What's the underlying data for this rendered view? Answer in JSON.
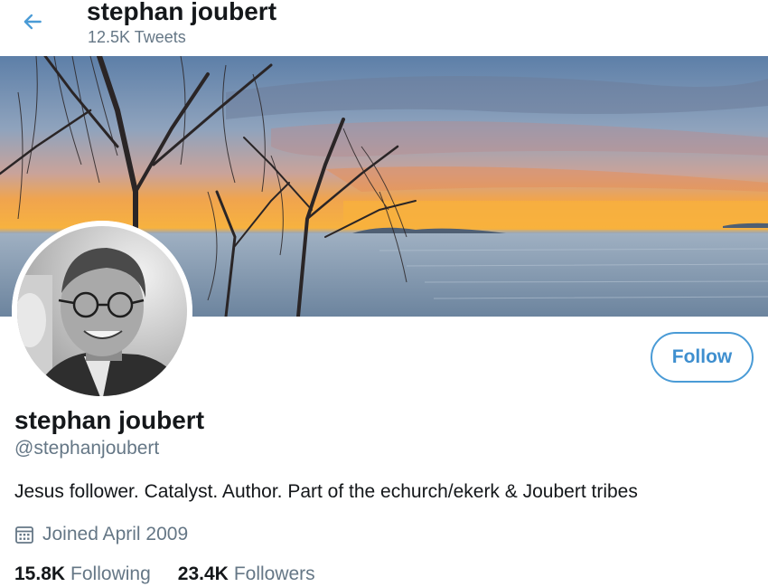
{
  "colors": {
    "accent": "#4a9bd6",
    "secondary_text": "#657786",
    "primary_text": "#14171a"
  },
  "header": {
    "back_icon": "arrow-left-icon",
    "name": "stephan joubert",
    "tweet_count": "12.5K Tweets"
  },
  "banner": {
    "description_icon": "sunset-banner-image"
  },
  "profile": {
    "avatar_icon": "profile-photo",
    "follow_label": "Follow",
    "name": "stephan joubert",
    "handle": "@stephanjoubert",
    "bio": "Jesus follower. Catalyst. Author. Part of the echurch/ekerk & Joubert tribes",
    "joined_icon": "calendar-icon",
    "joined": "Joined April 2009",
    "stats": [
      {
        "value": "15.8K",
        "label": "Following"
      },
      {
        "value": "23.4K",
        "label": "Followers"
      }
    ]
  }
}
